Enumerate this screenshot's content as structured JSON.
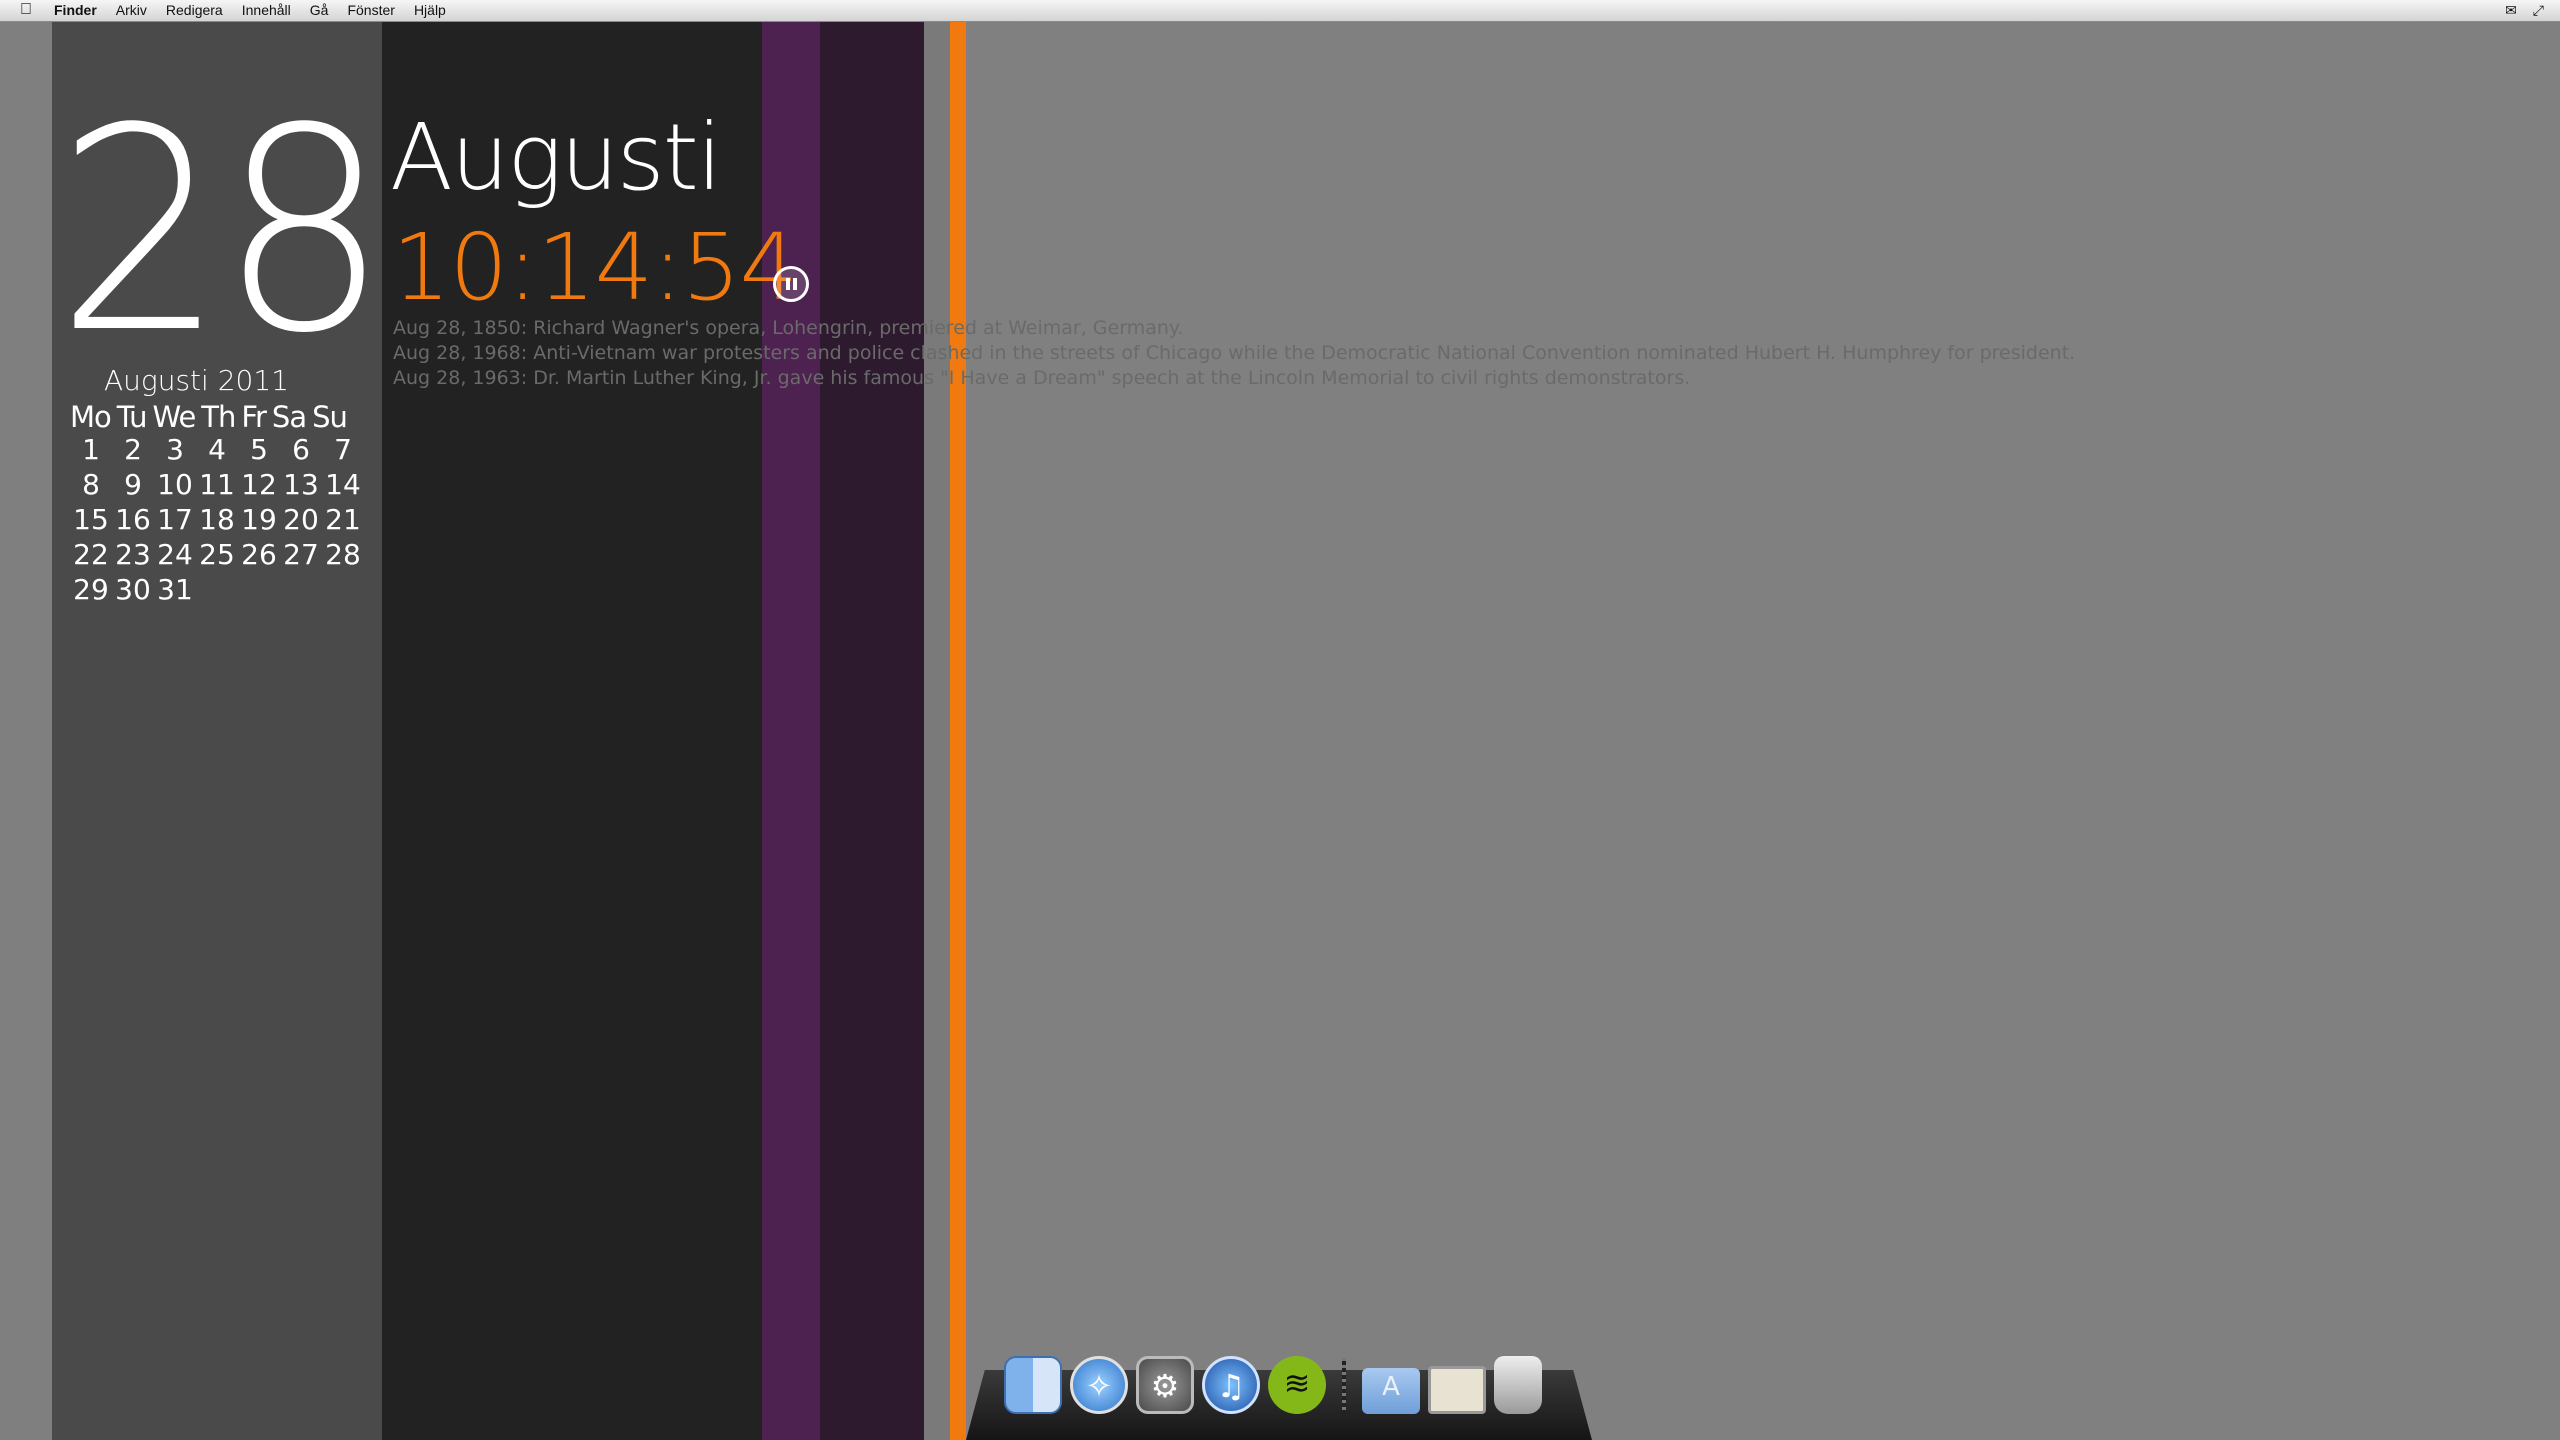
{
  "menubar": {
    "apple": "",
    "items": [
      "Finder",
      "Arkiv",
      "Redigera",
      "Innehåll",
      "Gå",
      "Fönster",
      "Hjälp"
    ],
    "right_icons": [
      "mail-icon",
      "fullscreen-icon"
    ]
  },
  "clock": {
    "day": "28",
    "month": "Augusti",
    "time": "10:14:54"
  },
  "events": [
    "Aug 28, 1850: Richard Wagner's opera, Lohengrin,  premiered at Weimar, Germany.",
    "Aug 28, 1968: Anti-Vietnam war protesters and police clashed in the streets of Chicago while the Democratic National Convention nominated Hubert H. Humphrey for president.",
    "Aug 28, 1963: Dr. Martin Luther King, Jr. gave his famous \"I Have a Dream\" speech at the Lincoln Memorial to civil rights demonstrators."
  ],
  "calendar": {
    "title": "Augusti 2011",
    "weekdays": [
      "Mo",
      "Tu",
      "We",
      "Th",
      "Fr",
      "Sa",
      "Su"
    ],
    "rows": [
      [
        "1",
        "2",
        "3",
        "4",
        "5",
        "6",
        "7"
      ],
      [
        "8",
        "9",
        "10",
        "11",
        "12",
        "13",
        "14"
      ],
      [
        "15",
        "16",
        "17",
        "18",
        "19",
        "20",
        "21"
      ],
      [
        "22",
        "23",
        "24",
        "25",
        "26",
        "27",
        "28"
      ],
      [
        "29",
        "30",
        "31"
      ]
    ]
  },
  "dock": {
    "apps": [
      "finder-icon",
      "safari-icon",
      "system-preferences-icon",
      "itunes-icon",
      "spotify-icon",
      "applications-folder-icon",
      "preview-icon",
      "trash-icon"
    ]
  },
  "colors": {
    "accent": "#f07a10",
    "purple": "#4e2250",
    "dark_purple": "#2e1a2f"
  }
}
